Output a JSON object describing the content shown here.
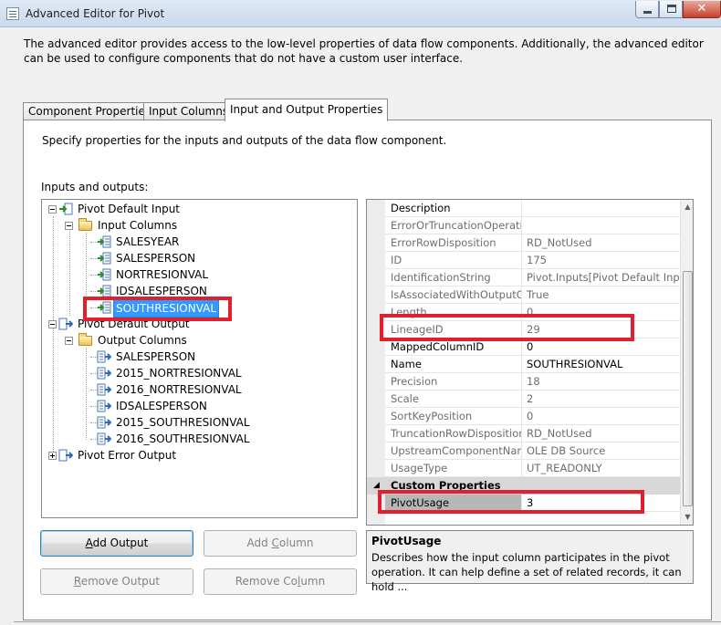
{
  "window": {
    "title": "Advanced Editor for Pivot"
  },
  "description": "The advanced editor provides access to the low-level properties of data flow components. Additionally, the advanced editor can be used to configure components that do not have a custom user interface.",
  "tabs": [
    {
      "label": "Component Properties",
      "active": false
    },
    {
      "label": "Input Columns",
      "active": false
    },
    {
      "label": "Input and Output Properties",
      "active": true
    }
  ],
  "panel": {
    "caption": "Specify properties for the inputs and outputs of the data flow component.",
    "tree_label": "Inputs and outputs:"
  },
  "tree": {
    "input": {
      "label": "Pivot Default Input",
      "folder": "Input Columns",
      "columns": [
        "SALESYEAR",
        "SALESPERSON",
        "NORTRESIONVAL",
        "IDSALESPERSON",
        "SOUTHRESIONVAL"
      ],
      "selected_column": "SOUTHRESIONVAL"
    },
    "output": {
      "label": "Pivot Default Output",
      "folder": "Output Columns",
      "columns": [
        "SALESPERSON",
        "2015_NORTRESIONVAL",
        "2016_NORTRESIONVAL",
        "IDSALESPERSON",
        "2015_SOUTHRESIONVAL",
        "2016_SOUTHRESIONVAL"
      ]
    },
    "error_output": {
      "label": "Pivot Error Output"
    }
  },
  "properties": {
    "common": [
      {
        "name": "Description",
        "value": "",
        "readonly": false
      },
      {
        "name": "ErrorOrTruncationOperation",
        "value": "",
        "readonly": true
      },
      {
        "name": "ErrorRowDisposition",
        "value": "RD_NotUsed",
        "readonly": true
      },
      {
        "name": "ID",
        "value": "175",
        "readonly": true
      },
      {
        "name": "IdentificationString",
        "value": "Pivot.Inputs[Pivot Default Input]",
        "readonly": true
      },
      {
        "name": "IsAssociatedWithOutputColumn",
        "value": "True",
        "readonly": true
      },
      {
        "name": "Length",
        "value": "0",
        "readonly": true
      },
      {
        "name": "LineageID",
        "value": "29",
        "readonly": true
      },
      {
        "name": "MappedColumnID",
        "value": "0",
        "readonly": false
      },
      {
        "name": "Name",
        "value": "SOUTHRESIONVAL",
        "readonly": false
      },
      {
        "name": "Precision",
        "value": "18",
        "readonly": true
      },
      {
        "name": "Scale",
        "value": "2",
        "readonly": true
      },
      {
        "name": "SortKeyPosition",
        "value": "0",
        "readonly": true
      },
      {
        "name": "TruncationRowDisposition",
        "value": "RD_NotUsed",
        "readonly": true
      },
      {
        "name": "UpstreamComponentName",
        "value": "OLE DB Source",
        "readonly": true
      },
      {
        "name": "UsageType",
        "value": "UT_READONLY",
        "readonly": true
      }
    ],
    "custom_category": "Custom Properties",
    "custom": [
      {
        "name": "PivotUsage",
        "value": "3",
        "readonly": false,
        "selected": true
      }
    ]
  },
  "description_pane": {
    "title": "PivotUsage",
    "body": "Describes how the input column participates in the pivot operation. It can help define a set of related records, it can hold ..."
  },
  "buttons": {
    "add_output": {
      "pre": "",
      "accel": "A",
      "post": "dd Output",
      "enabled": true
    },
    "add_column": {
      "pre": "Add ",
      "accel": "C",
      "post": "olumn",
      "enabled": false
    },
    "remove_output": {
      "pre": "",
      "accel": "R",
      "post": "emove Output",
      "enabled": false
    },
    "remove_column": {
      "pre": "Remove Co",
      "accel": "l",
      "post": "umn",
      "enabled": false
    }
  },
  "highlight_color": "#e0202c",
  "selection_color": "#3399ff"
}
